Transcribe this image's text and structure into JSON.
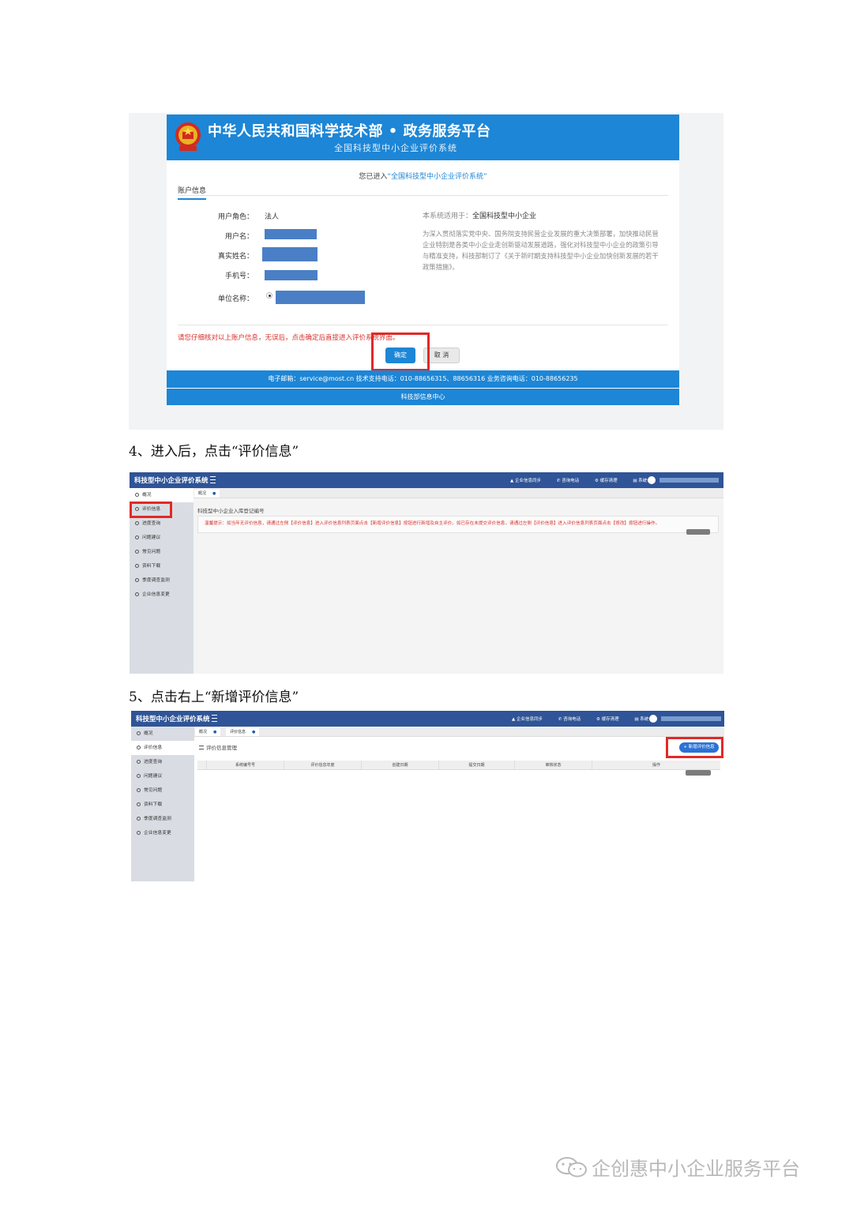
{
  "shot1": {
    "banner_title": "中华人民共和国科学技术部 • 政务服务平台",
    "banner_subtitle": "全国科技型中小企业评价系统",
    "welcome_prefix": "您已进入",
    "welcome_system": "“全国科技型中小企业评价系统”",
    "tab_account": "账户信息",
    "fields": {
      "role_label": "用户角色：",
      "role_value": "法人",
      "username_label": "用户名：",
      "realname_label": "真实姓名：",
      "phone_label": "手机号：",
      "company_label": "单位名称："
    },
    "notice_title_prefix": "本系统适用于：",
    "notice_title_value": "全国科技型中小企业",
    "notice_body": "为深入贯彻落实党中央、国务院支持民营企业发展的重大决策部署，加快推动民营企业特别是各类中小企业走创新驱动发展道路，强化对科技型中小企业的政策引导与精准支持，科技部制订了《关于新时期支持科技型中小企业加快创新发展的若干政策措施》。",
    "warning": "请您仔细核对以上账户信息，无误后，点击确定后直接进入评价系统界面。",
    "confirm_button": "确定",
    "cancel_button": "取 消",
    "footer_contact": "电子邮箱：service@most.cn      技术支持电话：010-88656315、88656316      业务咨询电话：010-88656235",
    "footer_org": "科技部信息中心"
  },
  "caption4": "4、进入后，点击“评价信息”",
  "caption5": "5、点击右上“新增评价信息”",
  "shot2": {
    "app_title": "科技型中小企业评价系统",
    "top_links": [
      "企业信息同步",
      "咨询电话",
      "缓存清理",
      "系统公告"
    ],
    "sidebar": [
      "概况",
      "评价信息",
      "进度查询",
      "问题建议",
      "常见问题",
      "资料下载",
      "季度调查监测",
      "企业信息变更"
    ],
    "tabs": [
      "概况"
    ],
    "register_title": "科技型中小企业入库登记编号",
    "tip": "温馨提示：如当年无评价信息，请通过左侧【评价信息】进入评价信息列表页面点击【新增评价信息】按钮进行新增及自主评价。如已存在未提交评价信息，请通过左侧【评价信息】进入评价信息列表页面点击【修改】按钮进行操作。"
  },
  "shot3": {
    "app_title": "科技型中小企业评价系统",
    "top_links": [
      "企业信息同步",
      "咨询电话",
      "缓存清理",
      "系统公告"
    ],
    "sidebar": [
      "概况",
      "评价信息",
      "进度查询",
      "问题建议",
      "常见问题",
      "资料下载",
      "季度调查监测",
      "企业信息变更"
    ],
    "tabs": [
      "概况",
      "评价信息"
    ],
    "section_title": "评价信息管理",
    "add_button": "+ 新增评价信息",
    "table_headers": [
      "系统编号号",
      "评价信息年度",
      "创建日期",
      "提交日期",
      "审核状态",
      "操作"
    ]
  },
  "watermark": "企创惠中小企业服务平台",
  "colors": {
    "banner_blue": "#1d86d6",
    "app_header": "#2f5497",
    "highlight_red": "#e02a27",
    "warning_red": "#d9302a"
  }
}
